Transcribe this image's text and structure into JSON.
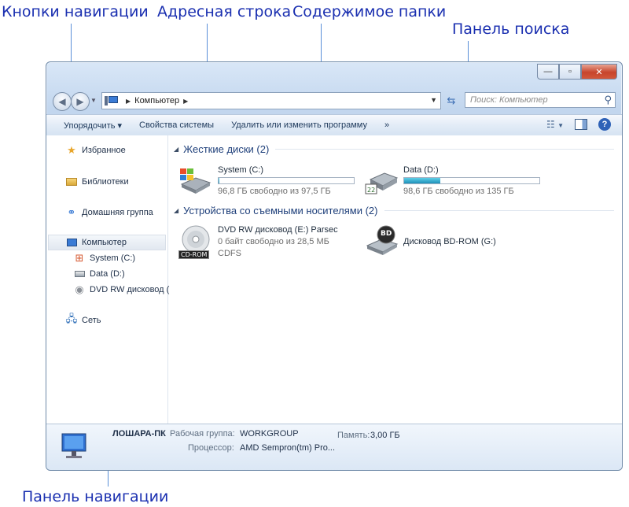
{
  "annotations": {
    "nav_buttons": "Кнопки навигации",
    "address_bar": "Адресная строка",
    "folder_content": "Содержимое папки",
    "search_panel": "Панель поиска",
    "nav_pane": "Панель навигации"
  },
  "window": {
    "controls": {
      "minimize": "—",
      "maximize": "▫",
      "close": "✕"
    }
  },
  "address": {
    "location": "Компьютер",
    "search_placeholder": "Поиск: Компьютер"
  },
  "toolbar": {
    "organize": "Упорядочить ▾",
    "system_properties": "Свойства системы",
    "uninstall": "Удалить или изменить программу",
    "more": "»"
  },
  "navpane": {
    "favorites": "Избранное",
    "libraries": "Библиотеки",
    "homegroup": "Домашняя группа",
    "computer": "Компьютер",
    "system_c": "System (C:)",
    "data_d": "Data (D:)",
    "dvd": "DVD RW дисковод (",
    "network": "Сеть"
  },
  "groups": {
    "hard_disks": "Жесткие диски (2)",
    "removable": "Устройства со съемными носителями (2)"
  },
  "drives": {
    "c": {
      "name": "System (C:)",
      "free": "96,8 ГБ свободно из 97,5 ГБ",
      "used_fraction": 0.007
    },
    "d": {
      "name": "Data (D:)",
      "free": "98,6 ГБ свободно из 135 ГБ",
      "used_fraction": 0.27
    },
    "dvd": {
      "name": "DVD RW дисковод (E:) Parsec",
      "free": "0 байт свободно из 28,5 МБ",
      "fs": "CDFS",
      "badge": "CD-ROM"
    },
    "bd": {
      "name": "Дисковод BD-ROM (G:)",
      "badge": "BD"
    }
  },
  "details": {
    "pc_name": "ЛОШАРА-ПК",
    "workgroup_label": "Рабочая группа:",
    "workgroup": "WORKGROUP",
    "memory_label": "Память:",
    "memory": "3,00 ГБ",
    "cpu_label": "Процессор:",
    "cpu": "AMD Sempron(tm) Pro..."
  }
}
